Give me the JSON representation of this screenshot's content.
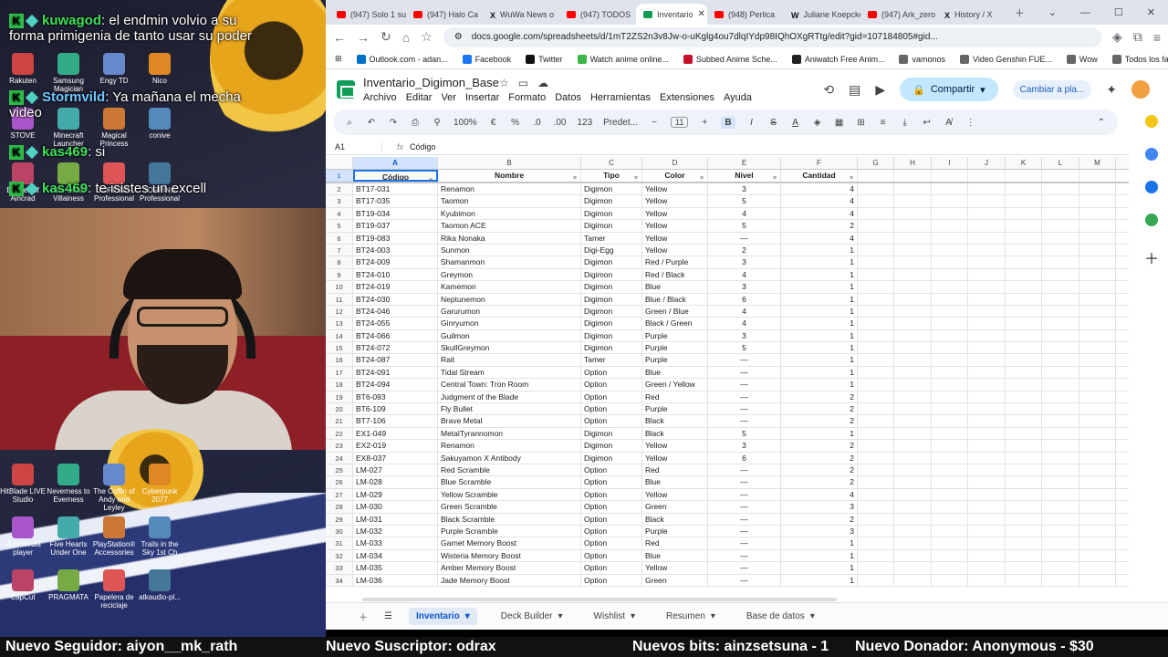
{
  "overlay": {
    "chat": [
      {
        "badge": "K",
        "user": "kuwagod",
        "text": ": el endmin volvio a su forma primigenia de tanto usar su poder"
      },
      {
        "badge": "K",
        "user": "Stormvild",
        "text": ": Ya mañana el mecha video"
      },
      {
        "badge": "K",
        "user": "kas469",
        "text": ": si"
      },
      {
        "badge": "K",
        "user": "kas469",
        "text": ": te isistes un excell"
      }
    ],
    "desktop_icons_top": [
      "Rakuten",
      "Samsung Magician",
      "Engy TD",
      "Nico",
      "STOVE",
      "Minecraft Launcher",
      "Magical Princess",
      "conive",
      "Echoes of Aincrad",
      "The Great Villainess",
      "TOPPING Professional",
      "TOPPING Professional"
    ],
    "desktop_icons_bottom": [
      "HitBlade LIVE Studio",
      "Neverness to Everness",
      "The Coffin of Andy and Leyley",
      "Cyberpunk 2077",
      "VLC media player",
      "Five Hearts Under One",
      "PlayStation® Accessories",
      "Trails in the Sky 1st Ch",
      "CapCut",
      "PRAGMATA",
      "Papelera de reciclaje",
      "atkaudio-pl..."
    ],
    "ticker": {
      "seguidor": "Nuevo Seguidor: aiyon__mk_rath",
      "suscriptor": "Nuevo Suscriptor: odrax",
      "bits": "Nuevos bits: ainzsetsuna - 1",
      "donador": "Nuevo Donador: Anonymous - $30"
    }
  },
  "browser": {
    "tabs": [
      {
        "icon": "yt",
        "label": "(947) Solo 1 su"
      },
      {
        "icon": "yt",
        "label": "(947) Halo Ca"
      },
      {
        "icon": "x",
        "label": "WuWa News o"
      },
      {
        "icon": "yt",
        "label": "(947) TODOS"
      },
      {
        "icon": "sheets",
        "label": "Inventario",
        "active": true
      },
      {
        "icon": "yt",
        "label": "(948) Perlica"
      },
      {
        "icon": "w",
        "label": "Juliane Koepcke"
      },
      {
        "icon": "yt",
        "label": "(947) Ark_zero"
      },
      {
        "icon": "x",
        "label": "History / X"
      }
    ],
    "url": "docs.google.com/spreadsheets/d/1mT2ZS2n3v8Jw-o-uKglg4ou7dlqIYdp98IQhOXgRTtg/edit?gid=107184805#gid...",
    "bookmarks": [
      "Outlook.com - adan...",
      "Facebook",
      "Twitter",
      "Watch anime online...",
      "Subbed Anime Sche...",
      "Aniwatch Free Anim...",
      "vamonos",
      "Video Genshin FUE...",
      "Wow",
      "Todos los favoritos"
    ]
  },
  "sheets": {
    "title": "Inventario_Digimon_Base",
    "menus": [
      "Archivo",
      "Editar",
      "Ver",
      "Insertar",
      "Formato",
      "Datos",
      "Herramientas",
      "Extensiones",
      "Ayuda"
    ],
    "share_label": "Compartir",
    "cambiar_label": "Cambiar a pla...",
    "zoom": "100%",
    "font": "Predet...",
    "font_size": "11",
    "currency": "€",
    "percent": "%",
    "dec_less": ".0",
    "dec_more": ".00",
    "num_format": "123",
    "cell_ref": "A1",
    "formula_value": "Código",
    "columns": [
      "A",
      "B",
      "C",
      "D",
      "E",
      "F",
      "G",
      "H",
      "I",
      "J",
      "K",
      "L",
      "M"
    ],
    "headers": [
      "Código",
      "Nombre",
      "Tipo",
      "Color",
      "Nivel",
      "Cantidad"
    ],
    "rows": [
      [
        "BT17-031",
        "Renamon",
        "Digimon",
        "Yellow",
        "3",
        "4"
      ],
      [
        "BT17-035",
        "Taomon",
        "Digimon",
        "Yellow",
        "5",
        "4"
      ],
      [
        "BT19-034",
        "Kyubimon",
        "Digimon",
        "Yellow",
        "4",
        "4"
      ],
      [
        "BT19-037",
        "Taomon ACE",
        "Digimon",
        "Yellow",
        "5",
        "2"
      ],
      [
        "BT19-083",
        "Rika Nonaka",
        "Tamer",
        "Yellow",
        "—",
        "4"
      ],
      [
        "BT24-003",
        "Sunmon",
        "Digi-Egg",
        "Yellow",
        "2",
        "1"
      ],
      [
        "BT24-009",
        "Shamanmon",
        "Digimon",
        "Red / Purple",
        "3",
        "1"
      ],
      [
        "BT24-010",
        "Greymon",
        "Digimon",
        "Red / Black",
        "4",
        "1"
      ],
      [
        "BT24-019",
        "Kamemon",
        "Digimon",
        "Blue",
        "3",
        "1"
      ],
      [
        "BT24-030",
        "Neptunemon",
        "Digimon",
        "Blue / Black",
        "6",
        "1"
      ],
      [
        "BT24-046",
        "Garurumon",
        "Digimon",
        "Green / Blue",
        "4",
        "1"
      ],
      [
        "BT24-055",
        "Ginryumon",
        "Digimon",
        "Black / Green",
        "4",
        "1"
      ],
      [
        "BT24-066",
        "Guilmon",
        "Digimon",
        "Purple",
        "3",
        "1"
      ],
      [
        "BT24-072",
        "SkullGreymon",
        "Digimon",
        "Purple",
        "5",
        "1"
      ],
      [
        "BT24-087",
        "Rait",
        "Tamer",
        "Purple",
        "—",
        "1"
      ],
      [
        "BT24-091",
        "Tidal Stream",
        "Option",
        "Blue",
        "—",
        "1"
      ],
      [
        "BT24-094",
        "Central Town: Tron Room",
        "Option",
        "Green / Yellow",
        "—",
        "1"
      ],
      [
        "BT6-093",
        "Judgment of the Blade",
        "Option",
        "Red",
        "—",
        "2"
      ],
      [
        "BT6-109",
        "Fly Bullet",
        "Option",
        "Purple",
        "—",
        "2"
      ],
      [
        "BT7-106",
        "Brave Metal",
        "Option",
        "Black",
        "—",
        "2"
      ],
      [
        "EX1-049",
        "MetalTyrannomon",
        "Digimon",
        "Black",
        "5",
        "1"
      ],
      [
        "EX2-019",
        "Renamon",
        "Digimon",
        "Yellow",
        "3",
        "2"
      ],
      [
        "EX8-037",
        "Sakuyamon X Antibody",
        "Digimon",
        "Yellow",
        "6",
        "2"
      ],
      [
        "LM-027",
        "Red Scramble",
        "Option",
        "Red",
        "—",
        "2"
      ],
      [
        "LM-028",
        "Blue Scramble",
        "Option",
        "Blue",
        "—",
        "2"
      ],
      [
        "LM-029",
        "Yellow Scramble",
        "Option",
        "Yellow",
        "—",
        "4"
      ],
      [
        "LM-030",
        "Green Scramble",
        "Option",
        "Green",
        "—",
        "3"
      ],
      [
        "LM-031",
        "Black Scramble",
        "Option",
        "Black",
        "—",
        "2"
      ],
      [
        "LM-032",
        "Purple Scramble",
        "Option",
        "Purple",
        "—",
        "3"
      ],
      [
        "LM-033",
        "Garnet Memory Boost",
        "Option",
        "Red",
        "—",
        "1"
      ],
      [
        "LM-034",
        "Wisteria Memory Boost",
        "Option",
        "Blue",
        "—",
        "1"
      ],
      [
        "LM-035",
        "Amber Memory Boost",
        "Option",
        "Yellow",
        "—",
        "1"
      ],
      [
        "LM-036",
        "Jade Memory Boost",
        "Option",
        "Green",
        "—",
        "1"
      ]
    ],
    "sheet_tabs": [
      "Inventario",
      "Deck Builder",
      "Wishlist",
      "Resumen",
      "Base de datos"
    ],
    "active_sheet": "Inventario"
  }
}
